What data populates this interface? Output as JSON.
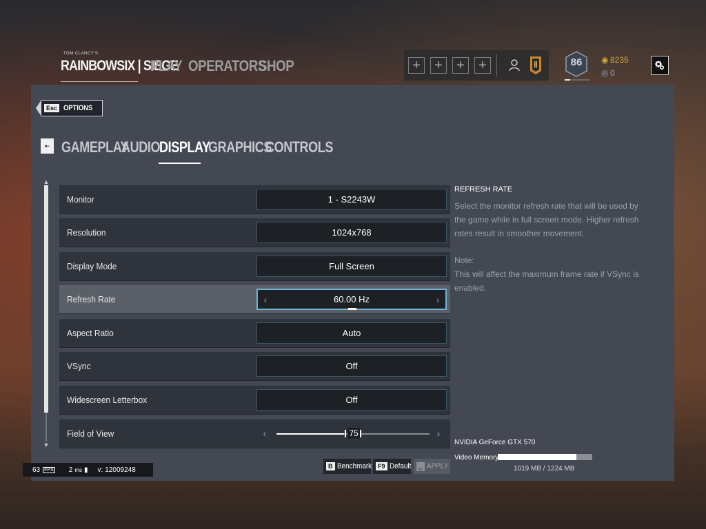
{
  "header": {
    "brand_small": "TOM CLANCY'S",
    "brand": "RAINBOWSIX | SIEGE",
    "nav": [
      "PLAY",
      "OPERATORS",
      "SHOP"
    ],
    "squad_slot_symbol": "+",
    "level": "86",
    "renown": "8235",
    "credits": "0"
  },
  "options": {
    "esc_key": "Esc",
    "esc_label": "OPTIONS",
    "tabs_icon_key": "⇤",
    "tabs": [
      "GAMEPLAY",
      "AUDIO",
      "DISPLAY",
      "GRAPHICS",
      "CONTROLS"
    ],
    "active_tab": "DISPLAY"
  },
  "settings": [
    {
      "label": "Monitor",
      "value": "1 - S2243W"
    },
    {
      "label": "Resolution",
      "value": "1024x768"
    },
    {
      "label": "Display Mode",
      "value": "Full Screen"
    },
    {
      "label": "Refresh Rate",
      "value": "60.00 Hz",
      "selected": true
    },
    {
      "label": "Aspect Ratio",
      "value": "Auto"
    },
    {
      "label": "VSync",
      "value": "Off"
    },
    {
      "label": "Widescreen Letterbox",
      "value": "Off"
    },
    {
      "label": "Field of View",
      "value": "75",
      "slider_fraction": 0.44
    }
  ],
  "help": {
    "title": "REFRESH RATE",
    "body": "Select the monitor refresh rate that will be used by the game while in full screen mode. Higher refresh rates result in smoother movement.",
    "note_title": "Note:",
    "note_body": "This will affect the maximum frame rate if VSync is enabled."
  },
  "gpu": {
    "name": "NVIDIA GeForce GTX 570",
    "memory_label": "Video Memory:",
    "memory_used_fraction": 0.832,
    "memory_text": "1019 MB / 1224 MB"
  },
  "buttons": {
    "benchmark_key": "B",
    "benchmark": "Benchmark",
    "default_key": "F9",
    "default": "Default",
    "apply_key": "␣",
    "apply": "APPLY"
  },
  "perf": {
    "fps": "63",
    "fps_unit": "FPS",
    "ping": "2",
    "ping_unit": "ms",
    "version_label": "v:",
    "version": "12009248"
  },
  "colors": {
    "accent": "#6fb4d6",
    "panel": "#434853",
    "row": "#2f333b",
    "row_selected": "#5b5f68",
    "renown": "#c9a640"
  }
}
